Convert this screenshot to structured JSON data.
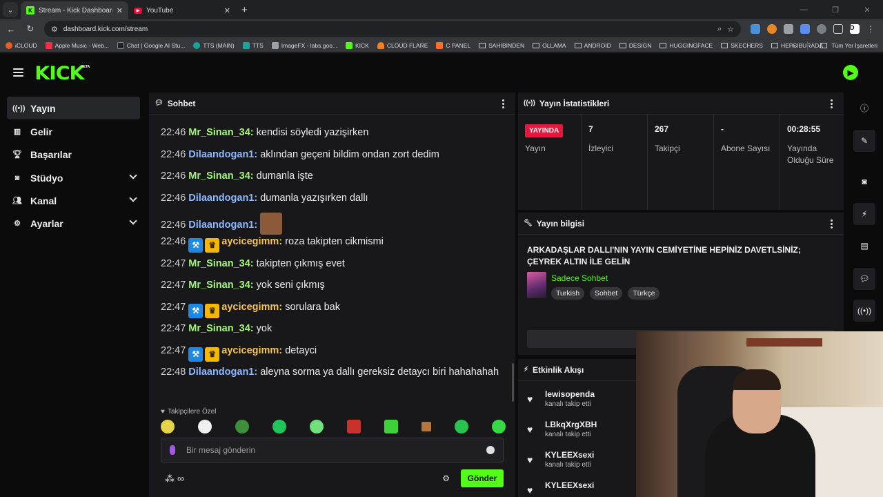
{
  "browser": {
    "tabs": [
      {
        "title": "Stream - Kick Dashboard",
        "favicon": "kick-icon",
        "active": true
      },
      {
        "title": "YouTube",
        "favicon": "youtube-icon",
        "active": false
      }
    ],
    "url": "dashboard.kick.com/stream",
    "bookmarks": [
      "iCLOUD",
      "Apple Music - Web...",
      "Chat | Google AI Stu...",
      "TTS (MAIN)",
      "TTS",
      "ImageFX - labs.goo...",
      "KICK",
      "CLOUD FLARE",
      "C PANEL",
      "SAHIBINDEN",
      "OLLAMA",
      "ANDROID",
      "DESIGN",
      "HUGGINGFACE",
      "SKECHERS",
      "HEPSIBURADA"
    ],
    "all_bookmarks": "Tüm Yer İşaretleri"
  },
  "logo": {
    "text": "KICK",
    "beta": "BETA"
  },
  "sidebar": {
    "items": [
      {
        "label": "Yayın",
        "icon": "broadcast-icon"
      },
      {
        "label": "Gelir",
        "icon": "chart-icon"
      },
      {
        "label": "Başarılar",
        "icon": "trophy-icon"
      },
      {
        "label": "Stüdyo",
        "icon": "studio-icon"
      },
      {
        "label": "Kanal",
        "icon": "users-icon"
      },
      {
        "label": "Ayarlar",
        "icon": "gear-icon"
      }
    ]
  },
  "chat": {
    "title": "Sohbet",
    "messages": [
      {
        "time": "22:46",
        "user": "Mr_Sinan_34:",
        "text": "kendisi söyledi yazişirken"
      },
      {
        "time": "22:46",
        "user": "Dilaandogan1:",
        "text": "aklından geçeni bildim ondan zort dedim"
      },
      {
        "time": "22:46",
        "user": "Mr_Sinan_34:",
        "text": "dumanla işte"
      },
      {
        "time": "22:46",
        "user": "Dilaandogan1:",
        "text": "dumanla yazışırken dallı"
      },
      {
        "time": "22:46",
        "user": "Dilaandogan1:",
        "text": ""
      },
      {
        "time": "22:46",
        "user": "aycicegimm:",
        "text": "roza takipten cikmismi"
      },
      {
        "time": "22:47",
        "user": "Mr_Sinan_34:",
        "text": "takipten çıkmış evet"
      },
      {
        "time": "22:47",
        "user": "Mr_Sinan_34:",
        "text": "yok seni çıkmış"
      },
      {
        "time": "22:47",
        "user": "aycicegimm:",
        "text": "sorulara bak"
      },
      {
        "time": "22:47",
        "user": "Mr_Sinan_34:",
        "text": "yok"
      },
      {
        "time": "22:47",
        "user": "aycicegimm:",
        "text": "detayci"
      },
      {
        "time": "22:48",
        "user": "Dilaandogan1:",
        "text": "aleyna sorma ya dallı gereksiz detaycı biri hahahahah"
      }
    ],
    "emote_section": "Takipçilere Özel",
    "input_placeholder": "Bir mesaj gönderin",
    "send_label": "Gönder",
    "points": "∞"
  },
  "stats": {
    "title": "Yayın İstatistikleri",
    "live_badge": "YAYINDA",
    "cells": [
      {
        "value": "",
        "label": "Yayın"
      },
      {
        "value": "7",
        "label": "İzleyici"
      },
      {
        "value": "267",
        "label": "Takipçi"
      },
      {
        "value": "-",
        "label": "Abone Sayısı"
      },
      {
        "value": "00:28:55",
        "label": "Yayında Olduğu Süre"
      }
    ]
  },
  "stream_info": {
    "title": "Yayın bilgisi",
    "stream_title": "ARKADAŞLAR DALLI'NIN YAYIN CEMİYETİNE HEPİNİZ DAVETLSİNİZ; ÇEYREK ALTIN İLE GELİN",
    "category": "Sadece Sohbet",
    "tags": [
      "Turkish",
      "Sohbet",
      "Türkçe"
    ]
  },
  "activity": {
    "title": "Etkinlik Akışı",
    "items": [
      {
        "name": "lewisopenda",
        "action": "kanalı takip etti"
      },
      {
        "name": "LBkqXrgXBH",
        "action": "kanalı takip etti"
      },
      {
        "name": "KYLEEXsexi",
        "action": "kanalı takip etti"
      },
      {
        "name": "KYLEEXsexi",
        "action": ""
      }
    ]
  },
  "colors": {
    "accent": "#53fc18",
    "live": "#e6173c",
    "panel": "#18181b",
    "mod_badge": "#1e88e5",
    "vip_badge": "#f5b700"
  }
}
